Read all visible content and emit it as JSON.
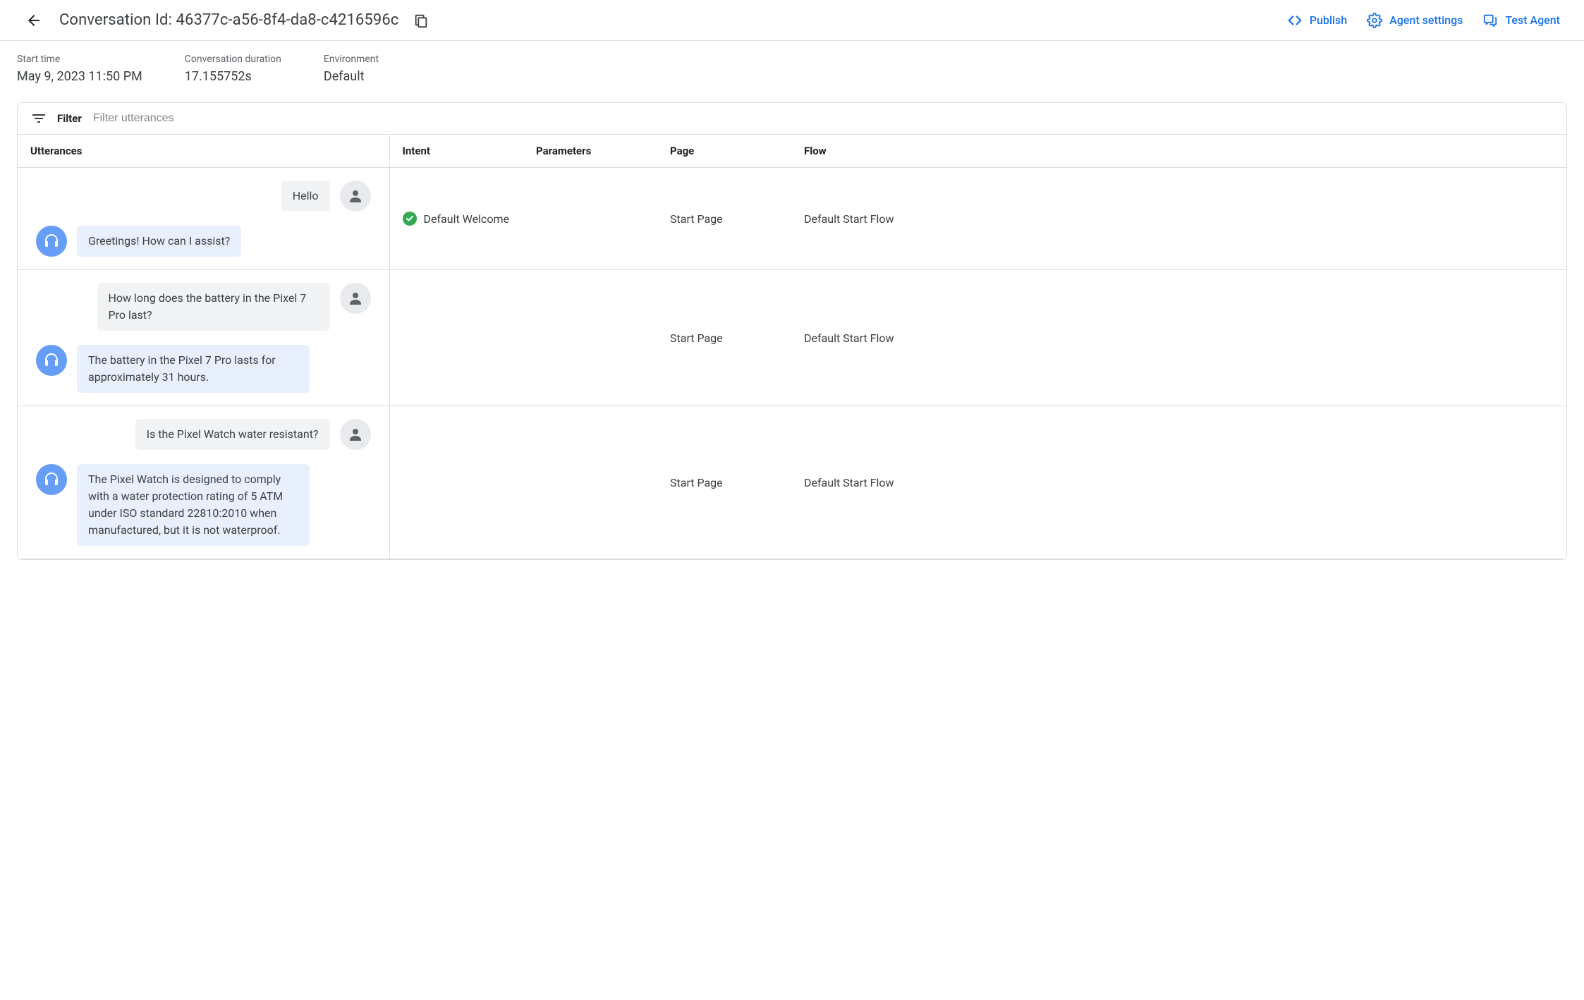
{
  "header": {
    "title": "Conversation Id: 46377c-a56-8f4-da8-c4216596c",
    "actions": {
      "publish": "Publish",
      "agent_settings": "Agent settings",
      "test_agent": "Test Agent"
    }
  },
  "meta": {
    "start_time": {
      "label": "Start time",
      "value": "May 9, 2023 11:50 PM"
    },
    "duration": {
      "label": "Conversation duration",
      "value": "17.155752s"
    },
    "environment": {
      "label": "Environment",
      "value": "Default"
    }
  },
  "filter": {
    "label": "Filter",
    "placeholder": "Filter utterances"
  },
  "columns": {
    "utterances": "Utterances",
    "intent": "Intent",
    "parameters": "Parameters",
    "page": "Page",
    "flow": "Flow"
  },
  "rows": [
    {
      "user": "Hello",
      "agent": "Greetings! How can I assist?",
      "intent_matched": true,
      "intent": "Default Welcome",
      "parameters": "",
      "page": "Start Page",
      "flow": "Default Start Flow"
    },
    {
      "user": "How long does the battery in the Pixel 7 Pro last?",
      "agent": "The battery in the Pixel 7 Pro lasts for approximately 31 hours.",
      "intent_matched": false,
      "intent": "",
      "parameters": "",
      "page": "Start Page",
      "flow": "Default Start Flow"
    },
    {
      "user": "Is the Pixel Watch water resistant?",
      "agent": "The Pixel Watch is designed to comply with a water protection rating of 5 ATM under ISO standard 22810:2010 when manufactured, but it is not waterproof.",
      "intent_matched": false,
      "intent": "",
      "parameters": "",
      "page": "Start Page",
      "flow": "Default Start Flow"
    }
  ]
}
